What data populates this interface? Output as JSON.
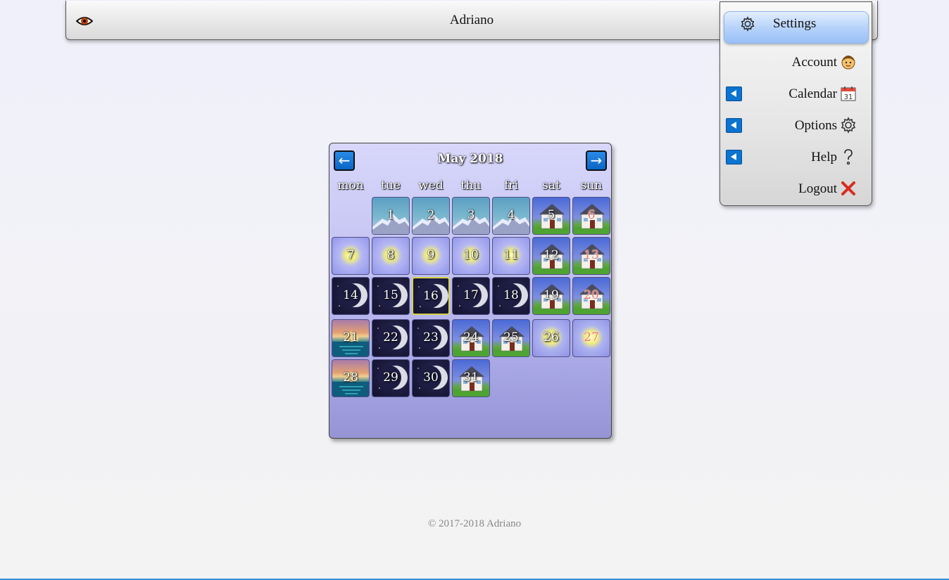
{
  "header": {
    "title": "Adriano",
    "eye_icon": "eye-icon"
  },
  "menu": {
    "settings": {
      "label": "Settings",
      "icon": "gear-icon"
    },
    "items": [
      {
        "label": "Account",
        "icon": "face-icon",
        "has_arrow": false
      },
      {
        "label": "Calendar",
        "icon": "calendar-icon",
        "has_arrow": true,
        "icon_text": "31"
      },
      {
        "label": "Options",
        "icon": "gear-icon",
        "has_arrow": true
      },
      {
        "label": "Help",
        "icon": "question-icon",
        "has_arrow": true
      },
      {
        "label": "Logout",
        "icon": "close-icon",
        "has_arrow": false
      }
    ]
  },
  "calendar": {
    "title": "May 2018",
    "prev_label": "←",
    "next_label": "→",
    "weekdays": [
      "mon",
      "tue",
      "wed",
      "thu",
      "fri",
      "sat",
      "sun"
    ],
    "today": 16,
    "weeks": [
      [
        null,
        {
          "day": 1,
          "theme": "mountain"
        },
        {
          "day": 2,
          "theme": "mountain"
        },
        {
          "day": 3,
          "theme": "mountain"
        },
        {
          "day": 4,
          "theme": "mountain"
        },
        {
          "day": 5,
          "theme": "house"
        },
        {
          "day": 6,
          "theme": "house",
          "red": true
        }
      ],
      [
        {
          "day": 7,
          "theme": "sun"
        },
        {
          "day": 8,
          "theme": "sun"
        },
        {
          "day": 9,
          "theme": "sun"
        },
        {
          "day": 10,
          "theme": "sun"
        },
        {
          "day": 11,
          "theme": "sun"
        },
        {
          "day": 12,
          "theme": "house"
        },
        {
          "day": 13,
          "theme": "house",
          "red": true
        }
      ],
      [
        {
          "day": 14,
          "theme": "moon"
        },
        {
          "day": 15,
          "theme": "moon"
        },
        {
          "day": 16,
          "theme": "moon"
        },
        {
          "day": 17,
          "theme": "moon"
        },
        {
          "day": 18,
          "theme": "moon"
        },
        {
          "day": 19,
          "theme": "house"
        },
        {
          "day": 20,
          "theme": "house",
          "red": true
        }
      ],
      [
        {
          "day": 21,
          "theme": "sunset"
        },
        {
          "day": 22,
          "theme": "moon"
        },
        {
          "day": 23,
          "theme": "moon"
        },
        {
          "day": 24,
          "theme": "house"
        },
        {
          "day": 25,
          "theme": "house"
        },
        {
          "day": 26,
          "theme": "sun2"
        },
        {
          "day": 27,
          "theme": "sun2",
          "red": true
        }
      ],
      [
        {
          "day": 28,
          "theme": "sunset"
        },
        {
          "day": 29,
          "theme": "moon"
        },
        {
          "day": 30,
          "theme": "moon"
        },
        {
          "day": 31,
          "theme": "house"
        },
        null,
        null,
        null
      ]
    ]
  },
  "footer": {
    "text": "© 2017-2018 Adriano"
  },
  "colors": {
    "accent_blue": "#0b73d0",
    "weekend_red": "#f2746a",
    "today_border": "#d6d14a"
  }
}
